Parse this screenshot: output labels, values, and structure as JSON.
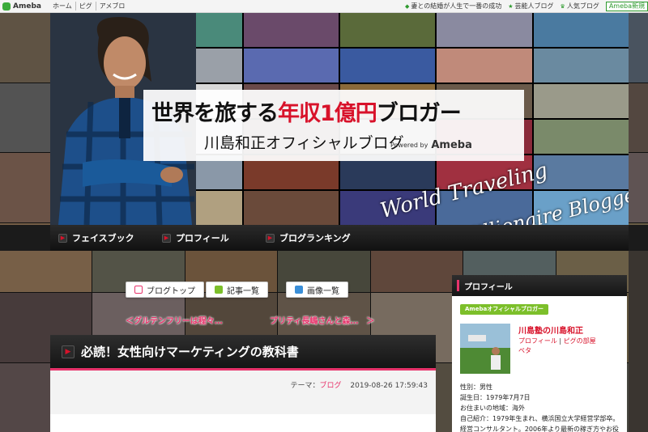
{
  "topbar": {
    "logo": "Ameba",
    "nav": [
      "ホーム",
      "ピグ",
      "アメブロ"
    ],
    "right_links": [
      "妻との結婚が人生で一番の成功",
      "芸能人ブログ",
      "人気ブログ"
    ],
    "new_button": "Ameba新規"
  },
  "banner": {
    "title_pre": "世界を旅する",
    "title_red": "年収1億円",
    "title_post": "ブロガー",
    "subtitle": "川島和正オフィシャルブログ",
    "powered_by": "Powered by",
    "powered_brand": "Ameba",
    "script_line1": "World Traveling",
    "script_line2": "Millionaire Blogger"
  },
  "navbar": {
    "items": [
      "フェイスブック",
      "プロフィール",
      "ブログランキング"
    ]
  },
  "blog_buttons": [
    "ブログトップ",
    "記事一覧",
    "画像一覧"
  ],
  "pager": {
    "prev": "＜グルテンフリーは程々…",
    "next": "プリティ長嶋さんと森…　＞"
  },
  "article": {
    "title": "必読！女性向けマーケティングの教科書",
    "theme_label": "テーマ：",
    "theme": "ブログ",
    "datetime": "2019-08-26 17:59:43"
  },
  "sidebar": {
    "header": "プロフィール",
    "badge": "Amebaオフィシャルブロガー",
    "name": "川島塾の川島和正",
    "link1": "プロフィール",
    "link_sep": "|",
    "link2": "ピグの部屋",
    "link3": "ペタ",
    "info": [
      "性別：男性",
      "誕生日：1979年7月7日",
      "お住まいの地域：海外",
      "自己紹介：1979年生まれ、横浜国立大学経営学部卒。",
      "経営コンサルタント。2006年より最新の稼ぎ方やお役"
    ]
  },
  "colors": {
    "accent_pink": "#e8336b",
    "accent_red": "#d8122a",
    "ameba_green": "#3bab3b",
    "nav_dark": "#151515"
  }
}
